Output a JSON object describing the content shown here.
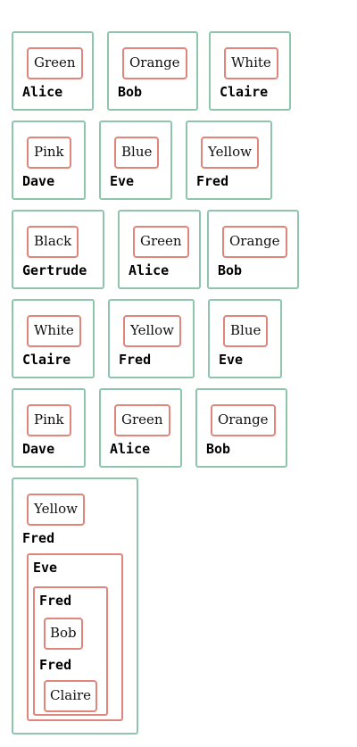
{
  "rows": [
    [
      {
        "color": "Green",
        "name": "Alice"
      },
      {
        "color": "Orange",
        "name": "Bob"
      },
      {
        "color": "White",
        "name": "Claire"
      }
    ],
    [
      {
        "color": "Pink",
        "name": "Dave"
      },
      {
        "color": "Blue",
        "name": "Eve"
      },
      {
        "color": "Yellow",
        "name": "Fred"
      }
    ],
    [
      {
        "color": "Black",
        "name": "Gertrude"
      },
      {
        "color": "Green",
        "name": "Alice"
      },
      {
        "color": "Orange",
        "name": "Bob"
      }
    ],
    [
      {
        "color": "White",
        "name": "Claire"
      },
      {
        "color": "Yellow",
        "name": "Fred"
      },
      {
        "color": "Blue",
        "name": "Eve"
      }
    ],
    [
      {
        "color": "Pink",
        "name": "Dave"
      },
      {
        "color": "Green",
        "name": "Alice"
      },
      {
        "color": "Orange",
        "name": "Bob"
      }
    ]
  ],
  "nested": {
    "color": "Yellow",
    "name": "Fred",
    "inner": {
      "name": "Eve",
      "inner": {
        "name": "Fred",
        "color": "Bob",
        "name2": "Fred",
        "color2": "Claire"
      }
    }
  },
  "colors": {
    "card_border": "#8fc4ad",
    "pill_border": "#e0857c"
  }
}
